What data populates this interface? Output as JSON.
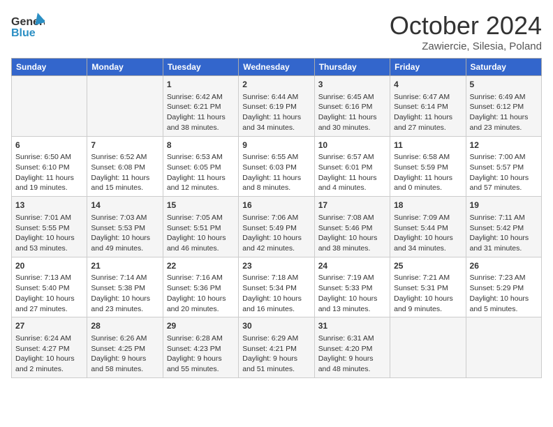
{
  "header": {
    "logo_general": "General",
    "logo_blue": "Blue",
    "month_title": "October 2024",
    "location": "Zawiercie, Silesia, Poland"
  },
  "days_of_week": [
    "Sunday",
    "Monday",
    "Tuesday",
    "Wednesday",
    "Thursday",
    "Friday",
    "Saturday"
  ],
  "weeks": [
    [
      {
        "day": "",
        "info": ""
      },
      {
        "day": "",
        "info": ""
      },
      {
        "day": "1",
        "info": "Sunrise: 6:42 AM\nSunset: 6:21 PM\nDaylight: 11 hours and 38 minutes."
      },
      {
        "day": "2",
        "info": "Sunrise: 6:44 AM\nSunset: 6:19 PM\nDaylight: 11 hours and 34 minutes."
      },
      {
        "day": "3",
        "info": "Sunrise: 6:45 AM\nSunset: 6:16 PM\nDaylight: 11 hours and 30 minutes."
      },
      {
        "day": "4",
        "info": "Sunrise: 6:47 AM\nSunset: 6:14 PM\nDaylight: 11 hours and 27 minutes."
      },
      {
        "day": "5",
        "info": "Sunrise: 6:49 AM\nSunset: 6:12 PM\nDaylight: 11 hours and 23 minutes."
      }
    ],
    [
      {
        "day": "6",
        "info": "Sunrise: 6:50 AM\nSunset: 6:10 PM\nDaylight: 11 hours and 19 minutes."
      },
      {
        "day": "7",
        "info": "Sunrise: 6:52 AM\nSunset: 6:08 PM\nDaylight: 11 hours and 15 minutes."
      },
      {
        "day": "8",
        "info": "Sunrise: 6:53 AM\nSunset: 6:05 PM\nDaylight: 11 hours and 12 minutes."
      },
      {
        "day": "9",
        "info": "Sunrise: 6:55 AM\nSunset: 6:03 PM\nDaylight: 11 hours and 8 minutes."
      },
      {
        "day": "10",
        "info": "Sunrise: 6:57 AM\nSunset: 6:01 PM\nDaylight: 11 hours and 4 minutes."
      },
      {
        "day": "11",
        "info": "Sunrise: 6:58 AM\nSunset: 5:59 PM\nDaylight: 11 hours and 0 minutes."
      },
      {
        "day": "12",
        "info": "Sunrise: 7:00 AM\nSunset: 5:57 PM\nDaylight: 10 hours and 57 minutes."
      }
    ],
    [
      {
        "day": "13",
        "info": "Sunrise: 7:01 AM\nSunset: 5:55 PM\nDaylight: 10 hours and 53 minutes."
      },
      {
        "day": "14",
        "info": "Sunrise: 7:03 AM\nSunset: 5:53 PM\nDaylight: 10 hours and 49 minutes."
      },
      {
        "day": "15",
        "info": "Sunrise: 7:05 AM\nSunset: 5:51 PM\nDaylight: 10 hours and 46 minutes."
      },
      {
        "day": "16",
        "info": "Sunrise: 7:06 AM\nSunset: 5:49 PM\nDaylight: 10 hours and 42 minutes."
      },
      {
        "day": "17",
        "info": "Sunrise: 7:08 AM\nSunset: 5:46 PM\nDaylight: 10 hours and 38 minutes."
      },
      {
        "day": "18",
        "info": "Sunrise: 7:09 AM\nSunset: 5:44 PM\nDaylight: 10 hours and 34 minutes."
      },
      {
        "day": "19",
        "info": "Sunrise: 7:11 AM\nSunset: 5:42 PM\nDaylight: 10 hours and 31 minutes."
      }
    ],
    [
      {
        "day": "20",
        "info": "Sunrise: 7:13 AM\nSunset: 5:40 PM\nDaylight: 10 hours and 27 minutes."
      },
      {
        "day": "21",
        "info": "Sunrise: 7:14 AM\nSunset: 5:38 PM\nDaylight: 10 hours and 23 minutes."
      },
      {
        "day": "22",
        "info": "Sunrise: 7:16 AM\nSunset: 5:36 PM\nDaylight: 10 hours and 20 minutes."
      },
      {
        "day": "23",
        "info": "Sunrise: 7:18 AM\nSunset: 5:34 PM\nDaylight: 10 hours and 16 minutes."
      },
      {
        "day": "24",
        "info": "Sunrise: 7:19 AM\nSunset: 5:33 PM\nDaylight: 10 hours and 13 minutes."
      },
      {
        "day": "25",
        "info": "Sunrise: 7:21 AM\nSunset: 5:31 PM\nDaylight: 10 hours and 9 minutes."
      },
      {
        "day": "26",
        "info": "Sunrise: 7:23 AM\nSunset: 5:29 PM\nDaylight: 10 hours and 5 minutes."
      }
    ],
    [
      {
        "day": "27",
        "info": "Sunrise: 6:24 AM\nSunset: 4:27 PM\nDaylight: 10 hours and 2 minutes."
      },
      {
        "day": "28",
        "info": "Sunrise: 6:26 AM\nSunset: 4:25 PM\nDaylight: 9 hours and 58 minutes."
      },
      {
        "day": "29",
        "info": "Sunrise: 6:28 AM\nSunset: 4:23 PM\nDaylight: 9 hours and 55 minutes."
      },
      {
        "day": "30",
        "info": "Sunrise: 6:29 AM\nSunset: 4:21 PM\nDaylight: 9 hours and 51 minutes."
      },
      {
        "day": "31",
        "info": "Sunrise: 6:31 AM\nSunset: 4:20 PM\nDaylight: 9 hours and 48 minutes."
      },
      {
        "day": "",
        "info": ""
      },
      {
        "day": "",
        "info": ""
      }
    ]
  ]
}
